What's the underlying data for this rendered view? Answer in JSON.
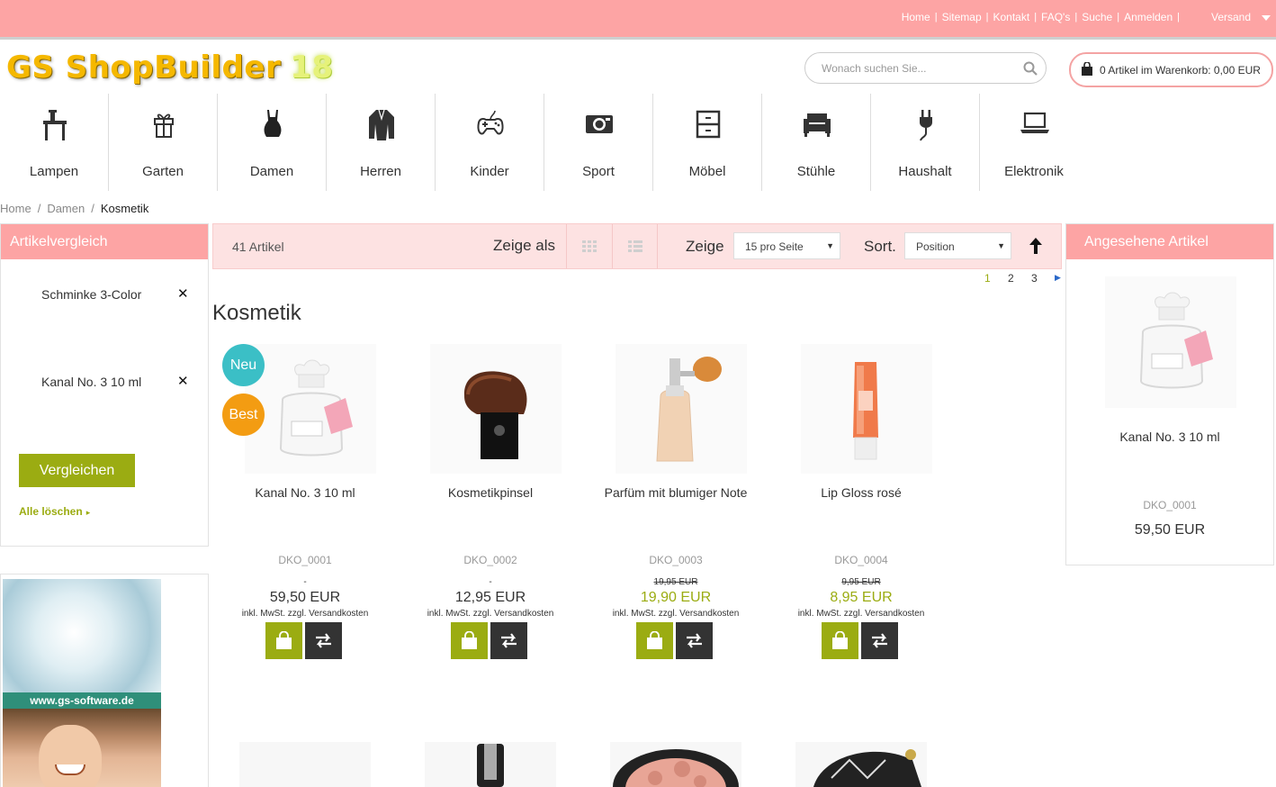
{
  "topbar": {
    "links": [
      "Home",
      "Sitemap",
      "Kontakt",
      "FAQ's",
      "Suche",
      "Anmelden"
    ],
    "versand": "Versand"
  },
  "logo": {
    "text": "GS ShopBuilder",
    "version": "18"
  },
  "search": {
    "placeholder": "Wonach suchen Sie..."
  },
  "cart": {
    "text": "0 Artikel im Warenkorb: 0,00 EUR"
  },
  "categories": [
    "Lampen",
    "Garten",
    "Damen",
    "Herren",
    "Kinder",
    "Sport",
    "Möbel",
    "Stühle",
    "Haushalt",
    "Elektronik"
  ],
  "breadcrumb": {
    "home": "Home",
    "parent": "Damen",
    "current": "Kosmetik",
    "separator": "/"
  },
  "compare": {
    "title": "Artikelvergleich",
    "items": [
      "Schminke 3-Color",
      "Kanal No. 3 10 ml"
    ],
    "remove_symbol": "✕",
    "button": "Vergleichen",
    "clear": "Alle löschen"
  },
  "banner": {
    "url": "www.gs-software.de"
  },
  "toolbar": {
    "count": "41 Artikel",
    "view_label": "Zeige als",
    "limit_label": "Zeige",
    "limit_value": "15 pro Seite",
    "sort_label": "Sort.",
    "sort_value": "Position"
  },
  "pager": {
    "pages": [
      "1",
      "2",
      "3"
    ],
    "current": "1"
  },
  "page_title": "Kosmetik",
  "products": [
    {
      "name": "Kanal No. 3 10 ml",
      "sku": "DKO_0001",
      "old_price": "-",
      "price": "59,50 EUR",
      "tax": "inkl. MwSt. zzgl. Versandkosten",
      "sale": false,
      "badges": [
        "Neu",
        "Best"
      ]
    },
    {
      "name": "Kosmetikpinsel",
      "sku": "DKO_0002",
      "old_price": "-",
      "price": "12,95 EUR",
      "tax": "inkl. MwSt. zzgl. Versandkosten",
      "sale": false,
      "badges": []
    },
    {
      "name": "Parfüm mit blumiger Note",
      "sku": "DKO_0003",
      "old_price": "19,95 EUR",
      "price": "19,90 EUR",
      "tax": "inkl. MwSt. zzgl. Versandkosten",
      "sale": true,
      "badges": []
    },
    {
      "name": "Lip Gloss rosé",
      "sku": "DKO_0004",
      "old_price": "9,95 EUR",
      "price": "8,95 EUR",
      "tax": "inkl. MwSt. zzgl. Versandkosten",
      "sale": true,
      "badges": []
    }
  ],
  "recent": {
    "title": "Angesehene Artikel",
    "name": "Kanal No. 3 10 ml",
    "sku": "DKO_0001",
    "price": "59,50 EUR"
  },
  "colors": {
    "brand_pink": "#fda4a4",
    "accent_green": "#9bac12",
    "dark": "#333333",
    "badge_new": "#3bbfc6",
    "badge_best": "#f39c12"
  }
}
